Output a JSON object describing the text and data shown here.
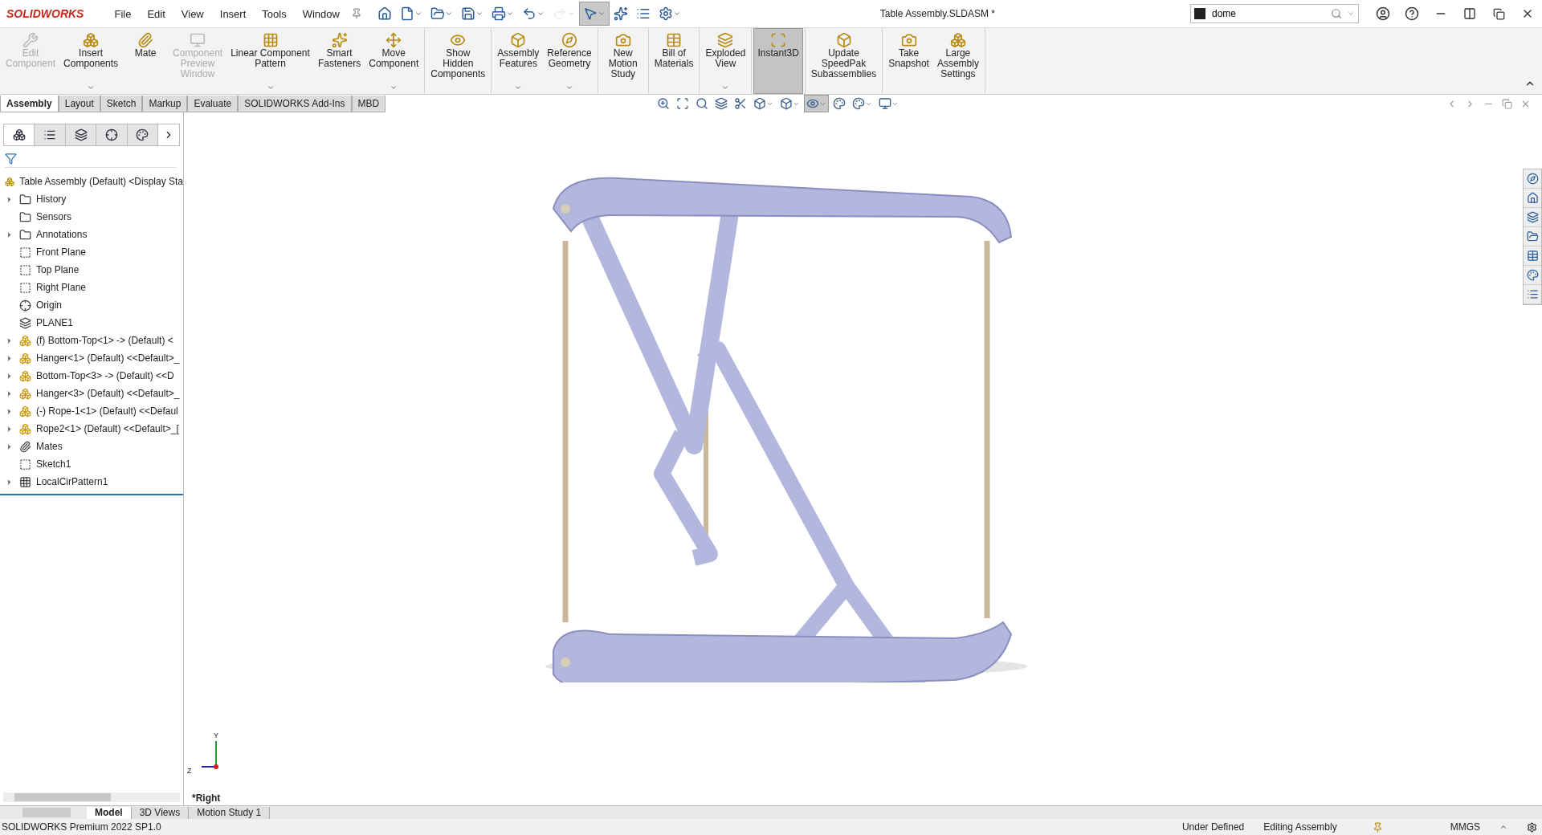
{
  "app": {
    "logo": "SOLIDWORKS",
    "title": "Table Assembly.SLDASM *"
  },
  "menu": [
    "File",
    "Edit",
    "View",
    "Insert",
    "Tools",
    "Window"
  ],
  "quick_access": [
    {
      "selected": false,
      "disabled": false,
      "dropdown": false
    },
    {
      "selected": false,
      "disabled": false,
      "dropdown": true
    },
    {
      "selected": false,
      "disabled": false,
      "dropdown": true
    },
    {
      "selected": false,
      "disabled": false,
      "dropdown": true
    },
    {
      "selected": false,
      "disabled": false,
      "dropdown": true
    },
    {
      "selected": false,
      "disabled": false,
      "dropdown": true
    },
    {
      "selected": false,
      "disabled": true,
      "dropdown": true
    },
    {
      "selected": true,
      "disabled": false,
      "dropdown": true
    },
    {
      "selected": false,
      "disabled": false,
      "dropdown": false
    },
    {
      "selected": false,
      "disabled": false,
      "dropdown": false
    },
    {
      "selected": false,
      "disabled": false,
      "dropdown": true
    }
  ],
  "search": {
    "value": "dome"
  },
  "ribbon_groups": [
    [
      {
        "label": "Edit\nComponent",
        "disabled": true,
        "selected": false,
        "dropdown": false
      },
      {
        "label": "Insert\nComponents",
        "disabled": false,
        "selected": false,
        "dropdown": true
      },
      {
        "label": "Mate",
        "disabled": false,
        "selected": false,
        "dropdown": false
      },
      {
        "label": "Component\nPreview\nWindow",
        "disabled": true,
        "selected": false,
        "dropdown": false
      },
      {
        "label": "Linear Component\nPattern",
        "disabled": false,
        "selected": false,
        "dropdown": true
      },
      {
        "label": "Smart\nFasteners",
        "disabled": false,
        "selected": false,
        "dropdown": false
      },
      {
        "label": "Move\nComponent",
        "disabled": false,
        "selected": false,
        "dropdown": true
      }
    ],
    [
      {
        "label": "Show\nHidden\nComponents",
        "disabled": false,
        "selected": false,
        "dropdown": false
      }
    ],
    [
      {
        "label": "Assembly\nFeatures",
        "disabled": false,
        "selected": false,
        "dropdown": true
      },
      {
        "label": "Reference\nGeometry",
        "disabled": false,
        "selected": false,
        "dropdown": true
      }
    ],
    [
      {
        "label": "New\nMotion\nStudy",
        "disabled": false,
        "selected": false,
        "dropdown": false
      }
    ],
    [
      {
        "label": "Bill of\nMaterials",
        "disabled": false,
        "selected": false,
        "dropdown": false
      }
    ],
    [
      {
        "label": "Exploded\nView",
        "disabled": false,
        "selected": false,
        "dropdown": true
      }
    ],
    [
      {
        "label": "Instant3D",
        "disabled": false,
        "selected": true,
        "dropdown": false
      }
    ],
    [
      {
        "label": "Update\nSpeedPak\nSubassemblies",
        "disabled": false,
        "selected": false,
        "dropdown": false
      }
    ],
    [
      {
        "label": "Take\nSnapshot",
        "disabled": false,
        "selected": false,
        "dropdown": false
      },
      {
        "label": "Large\nAssembly\nSettings",
        "disabled": false,
        "selected": false,
        "dropdown": false
      }
    ]
  ],
  "tabs": [
    {
      "label": "Assembly",
      "selected": true
    },
    {
      "label": "Layout",
      "selected": false
    },
    {
      "label": "Sketch",
      "selected": false
    },
    {
      "label": "Markup",
      "selected": false
    },
    {
      "label": "Evaluate",
      "selected": false
    },
    {
      "label": "SOLIDWORKS Add-Ins",
      "selected": false
    },
    {
      "label": "MBD",
      "selected": false
    }
  ],
  "heads_up_toolbar": [
    {
      "selected": false,
      "dropdown": false
    },
    {
      "selected": false,
      "dropdown": false
    },
    {
      "selected": false,
      "dropdown": false
    },
    {
      "selected": false,
      "dropdown": false
    },
    {
      "selected": false,
      "dropdown": false
    },
    {
      "selected": false,
      "dropdown": true
    },
    {
      "selected": false,
      "dropdown": true
    },
    {
      "selected": true,
      "dropdown": true
    },
    {
      "selected": false,
      "dropdown": false
    },
    {
      "selected": false,
      "dropdown": true
    },
    {
      "selected": false,
      "dropdown": true
    }
  ],
  "panel_tabs": [
    {
      "selected": true
    },
    {
      "selected": false
    },
    {
      "selected": false
    },
    {
      "selected": false
    },
    {
      "selected": false
    }
  ],
  "tree": {
    "root": "Table Assembly (Default) <Display Sta",
    "items": [
      {
        "kind": "history",
        "label": "History",
        "expandable": true
      },
      {
        "kind": "sensors",
        "label": "Sensors",
        "expandable": false
      },
      {
        "kind": "annotations",
        "label": "Annotations",
        "expandable": true
      },
      {
        "kind": "plane",
        "label": "Front Plane",
        "expandable": false
      },
      {
        "kind": "plane",
        "label": "Top Plane",
        "expandable": false
      },
      {
        "kind": "plane",
        "label": "Right Plane",
        "expandable": false
      },
      {
        "kind": "origin",
        "label": "Origin",
        "expandable": false
      },
      {
        "kind": "plane-solid",
        "label": "PLANE1",
        "expandable": false
      },
      {
        "kind": "part",
        "label": "(f) Bottom-Top<1> -> (Default) <",
        "expandable": true
      },
      {
        "kind": "part",
        "label": "Hanger<1> (Default) <<Default>_",
        "expandable": true
      },
      {
        "kind": "part",
        "label": "Bottom-Top<3> -> (Default) <<D",
        "expandable": true
      },
      {
        "kind": "part",
        "label": "Hanger<3> (Default) <<Default>_",
        "expandable": true
      },
      {
        "kind": "part",
        "label": "(-) Rope-1<1> (Default) <<Defaul",
        "expandable": true
      },
      {
        "kind": "part",
        "label": "Rope2<1> (Default) <<Default>_[",
        "expandable": true
      },
      {
        "kind": "mates",
        "label": "Mates",
        "expandable": true
      },
      {
        "kind": "sketch",
        "label": "Sketch1",
        "expandable": false
      },
      {
        "kind": "pattern",
        "label": "LocalCirPattern1",
        "expandable": true
      }
    ]
  },
  "viewport": {
    "view_name": "*Right",
    "axis_y": "Y",
    "axis_z": "Z"
  },
  "bottom_tabs": [
    {
      "label": "Model",
      "selected": true
    },
    {
      "label": "3D Views",
      "selected": false
    },
    {
      "label": "Motion Study 1",
      "selected": false
    }
  ],
  "status_bar": {
    "product": "SOLIDWORKS Premium 2022 SP1.0",
    "state": "Under Defined",
    "mode": "Editing Assembly",
    "units": "MMGS"
  }
}
